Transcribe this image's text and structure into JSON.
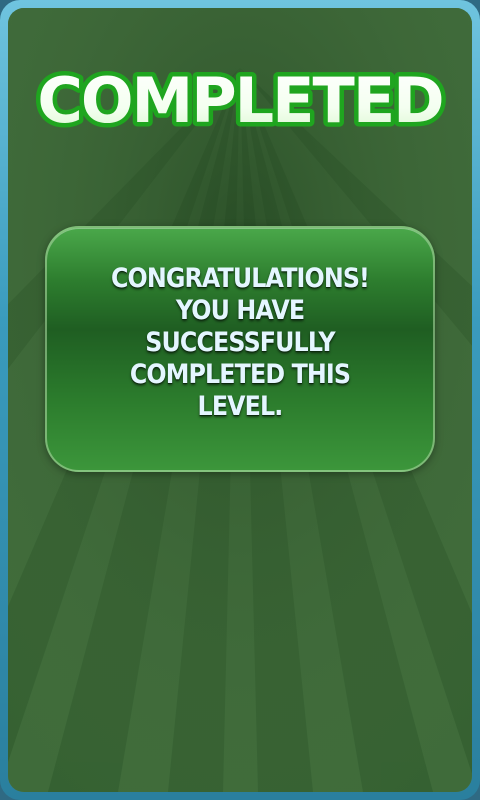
{
  "screen": {
    "title": "COMPLETED",
    "message": "CONGRATULATIONS! YOU HAVE SUCCESSFULLY COMPLETED THIS LEVEL."
  },
  "colors": {
    "frame_border": "#3a9bbd",
    "panel_background": "#3e6a38",
    "title_fill": "#ffffff",
    "title_outline": "#1fa51f",
    "message_box": "#2d7d2e",
    "message_text": "#e4f6ff"
  }
}
